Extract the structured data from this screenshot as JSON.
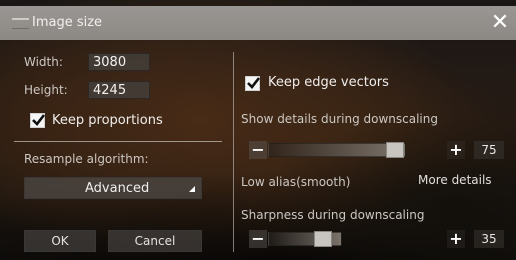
{
  "window": {
    "title": "Image size",
    "close_icon": "close-icon"
  },
  "size": {
    "width_label": "Width:",
    "width_value": "3080",
    "height_label": "Height:",
    "height_value": "4245",
    "keep_proportions_label": "Keep proportions",
    "keep_proportions_checked": true
  },
  "resample": {
    "label": "Resample algorithm:",
    "selected": "Advanced"
  },
  "buttons": {
    "ok": "OK",
    "cancel": "Cancel"
  },
  "right": {
    "keep_edge_label": "Keep edge vectors",
    "keep_edge_checked": true,
    "details_label": "Show details during downscaling",
    "details_value": "75",
    "details_level": 0.75,
    "low_alias_label": "Low alias(smooth)",
    "more_details_label": "More details",
    "sharpness_label": "Sharpness during downscaling",
    "sharpness_value": "35",
    "sharpness_level": 0.35,
    "minus_symbol": "−",
    "plus_symbol": "+"
  },
  "colors": {
    "titlebar": "#8c8884",
    "text": "#cbc7c2",
    "checkbox": "#f5f5f5"
  }
}
